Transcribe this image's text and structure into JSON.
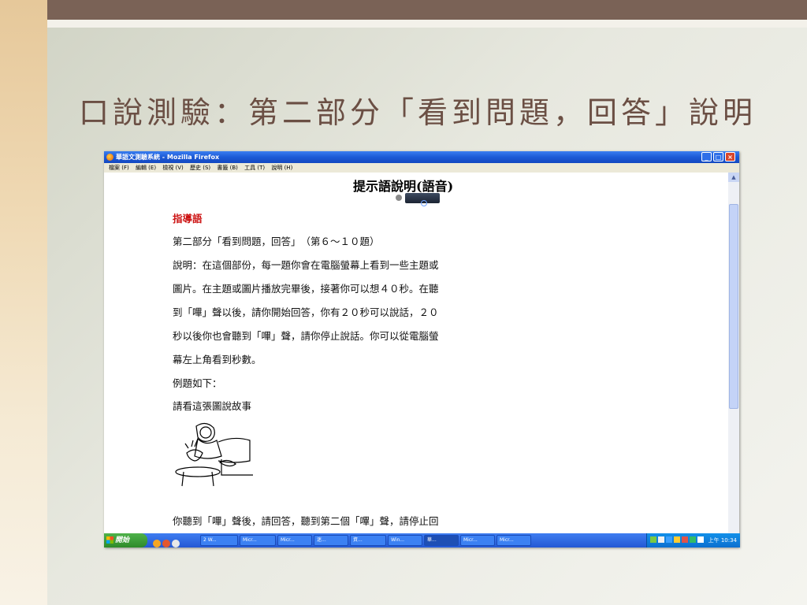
{
  "slide": {
    "title": "口說測驗：第二部分「看到問題，回答」說明"
  },
  "window": {
    "title": "華語文測驗系統 - Mozilla Firefox",
    "minimize_icon": "minimize-icon",
    "maximize_icon": "maximize-icon",
    "close_icon": "close-icon"
  },
  "menu": {
    "items": [
      "檔案 (F)",
      "編輯 (E)",
      "檢視 (V)",
      "歷史 (S)",
      "書籤 (B)",
      "工具 (T)",
      "說明 (H)"
    ]
  },
  "page": {
    "heading": "提示語說明(語音)",
    "guide_label": "指導語",
    "lines": [
      "第二部分「看到問題，回答」　（第６～１０題）",
      "說明：在這個部份，每一題你會在電腦螢幕上看到一些主題或",
      "圖片。在主題或圖片播放完畢後，接著你可以想４０秒。在聽",
      "到「嗶」聲以後，請你開始回答，你有２０秒可以說話，２０",
      "秒以後你也會聽到「嗶」聲，請你停止說話。你可以從電腦螢",
      "幕左上角看到秒數。",
      "例題如下：",
      "請看這張圖說故事"
    ],
    "bottom_line": "你聽到「嗶」聲後，請回答，聽到第二個「嗶」聲，請停止回"
  },
  "taskbar": {
    "start_label": "開始",
    "buttons": [
      "2 W...",
      "Micr...",
      "Micr...",
      "迷...",
      "資...",
      "Win...",
      "華...",
      "Micr...",
      "Micr..."
    ],
    "clock": "上午 10:34"
  }
}
